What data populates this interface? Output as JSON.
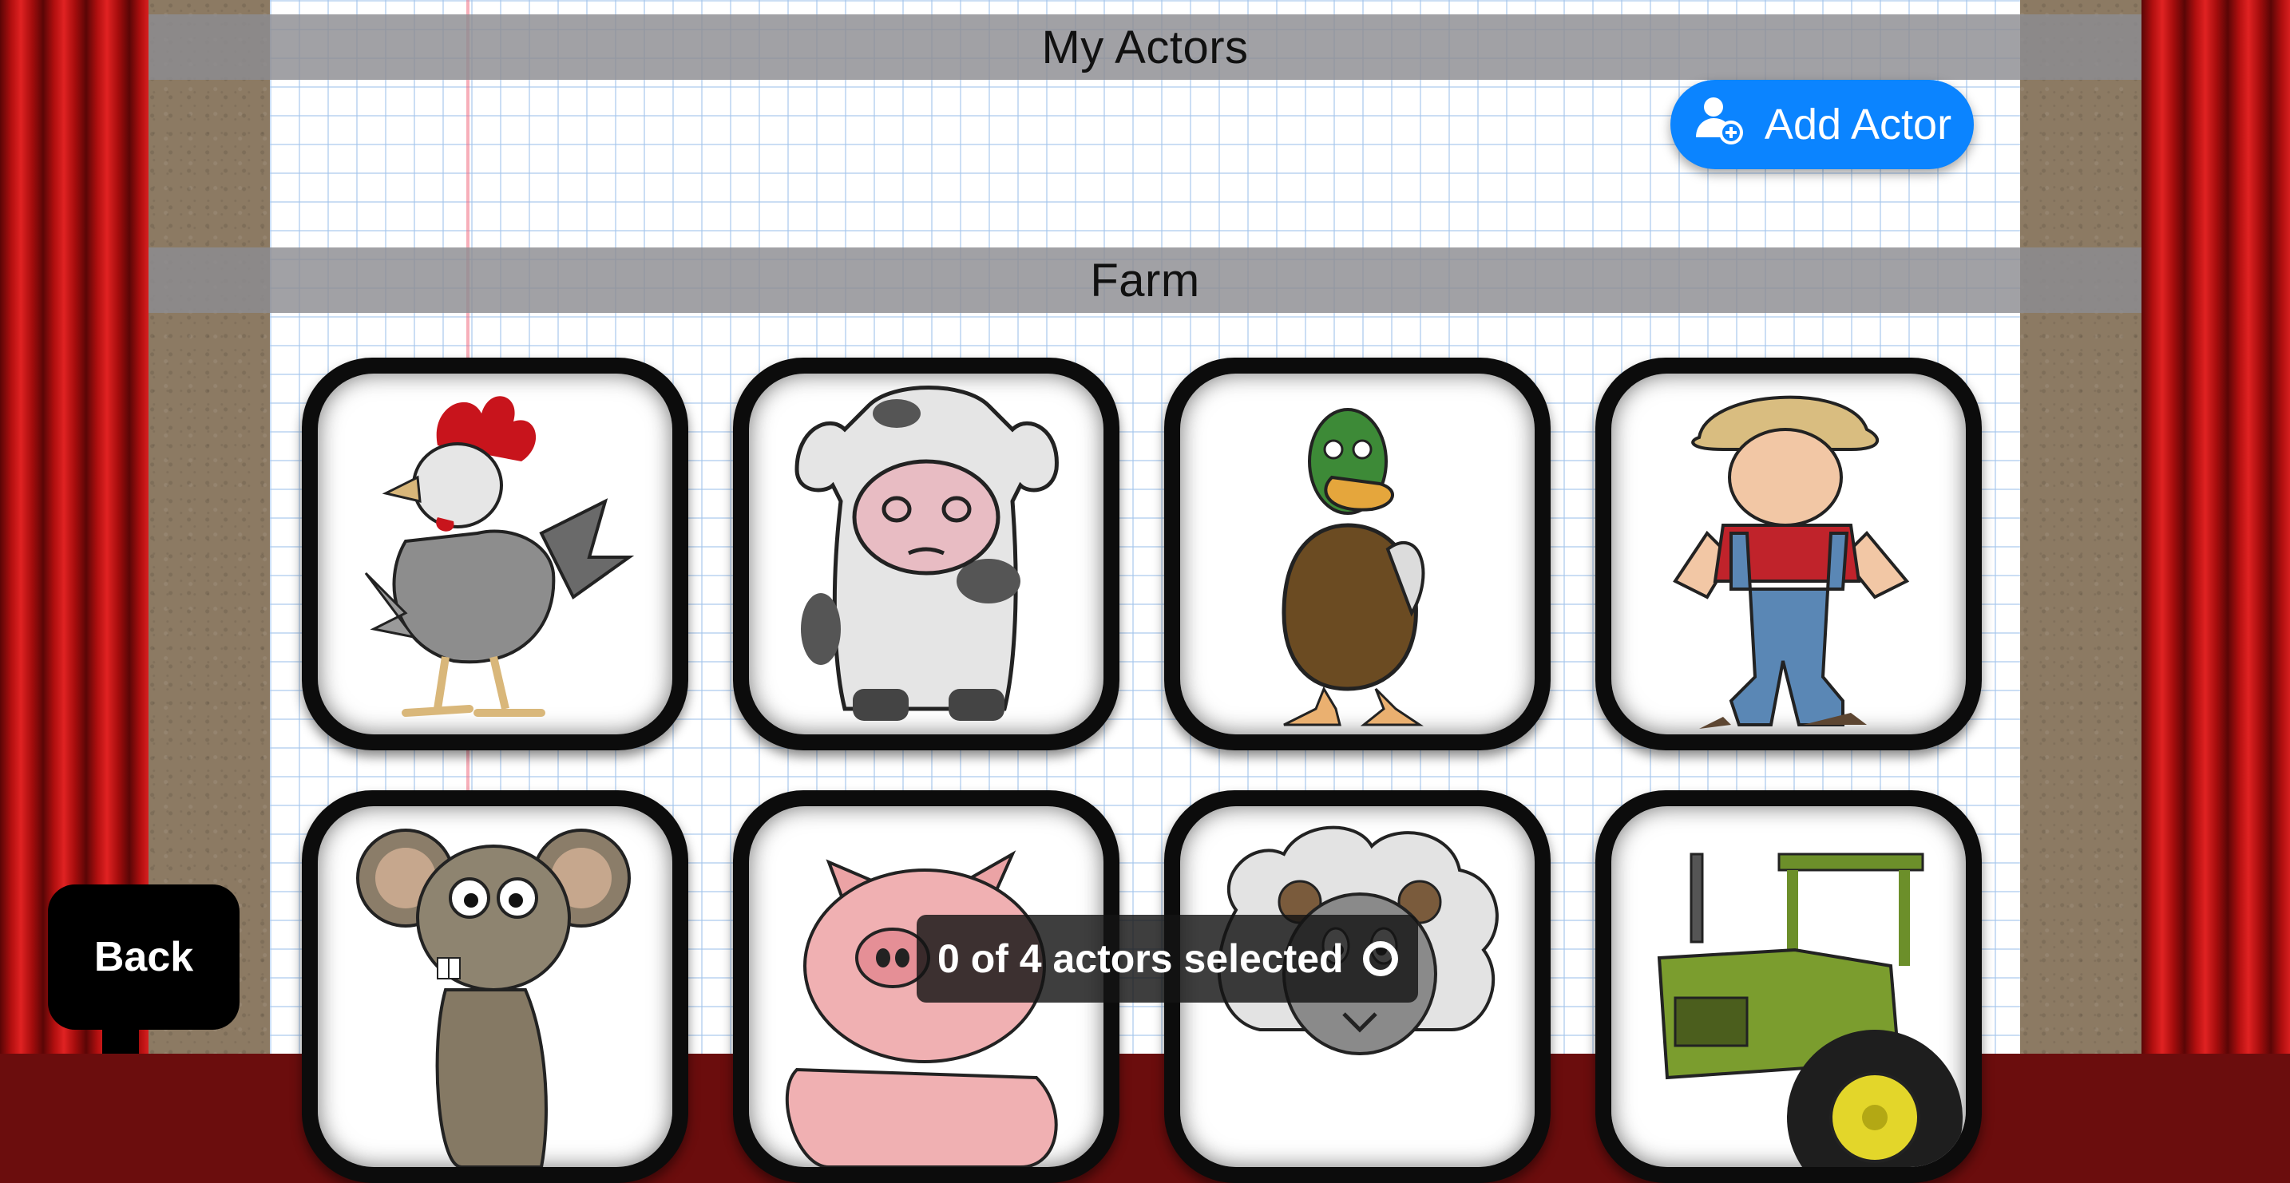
{
  "sections": {
    "my_actors": "My Actors",
    "farm": "Farm"
  },
  "buttons": {
    "add_actor": "Add Actor",
    "back": "Back"
  },
  "status": {
    "selection": "0 of 4 actors selected"
  },
  "actors": [
    {
      "name": "rooster"
    },
    {
      "name": "cow"
    },
    {
      "name": "duck"
    },
    {
      "name": "farmer"
    },
    {
      "name": "mouse"
    },
    {
      "name": "pig"
    },
    {
      "name": "sheep"
    },
    {
      "name": "tractor"
    }
  ],
  "colors": {
    "accent": "#0b84ff",
    "curtain": "#b10f0f",
    "header": "#8c8c91"
  }
}
